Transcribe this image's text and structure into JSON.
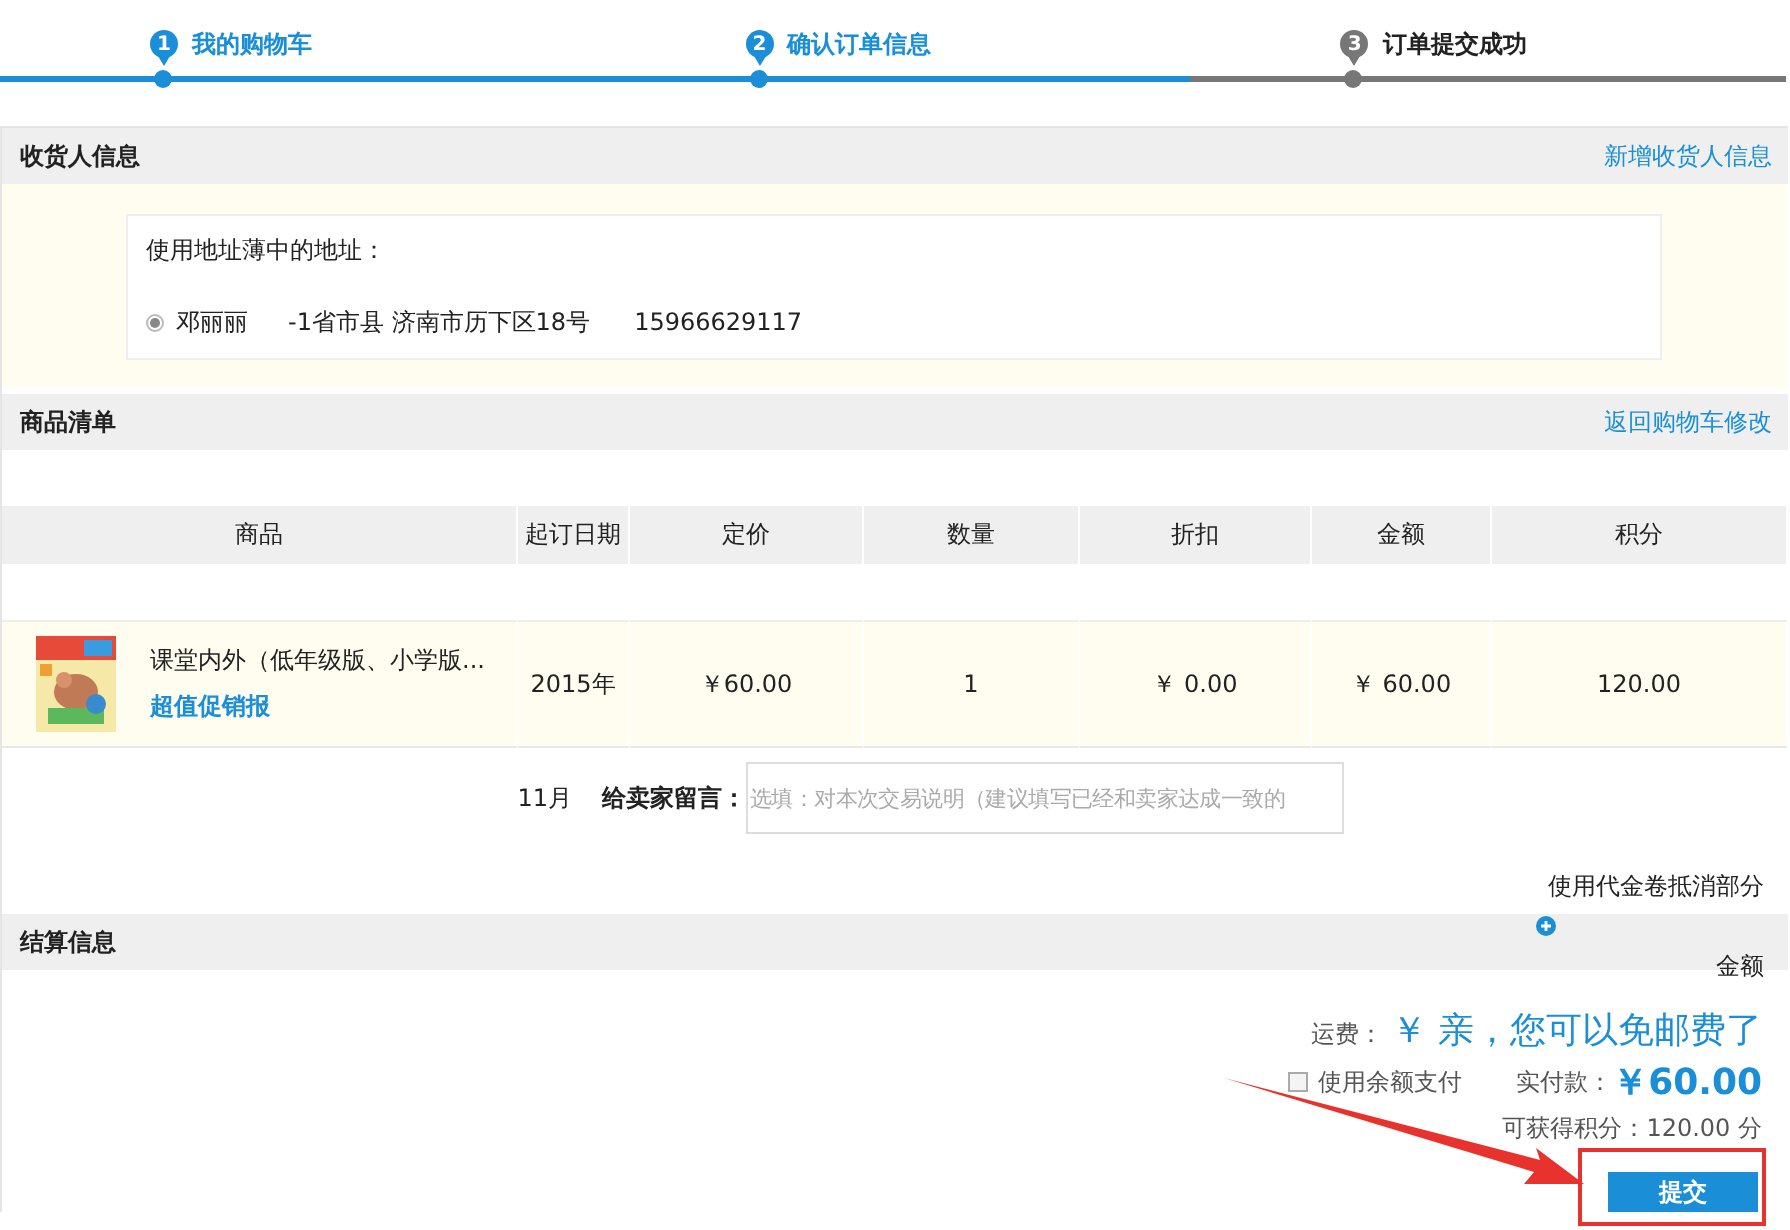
{
  "steps": [
    {
      "number": "1",
      "label": "我的购物车",
      "completed": true
    },
    {
      "number": "2",
      "label": "确认订单信息",
      "completed": true
    },
    {
      "number": "3",
      "label": "订单提交成功",
      "completed": false
    }
  ],
  "recipient": {
    "title": "收货人信息",
    "link": "新增收货人信息",
    "prompt": "使用地址薄中的地址：",
    "addresses": [
      {
        "selected": true,
        "name": "邓丽丽",
        "address": "-1省市县 济南市历下区18号",
        "phone": "15966629117"
      }
    ]
  },
  "goods": {
    "title": "商品清单",
    "link": "返回购物车修改",
    "columns": [
      "商品",
      "起订日期",
      "定价",
      "数量",
      "折扣",
      "金额",
      "积分"
    ],
    "rows": [
      {
        "kind": "picture",
        "product": "课堂内外（低年级版、小学版...",
        "promo": "超值促销报",
        "date": "2015年",
        "date_more": "11月",
        "price": "￥60.00",
        "quantity": "1",
        "discount": "￥ 0.00",
        "amount": "￥ 60.00",
        "points": "120.00"
      }
    ],
    "message": {
      "label": "给卖家留言：",
      "placeholder": "选填：对本次交易说明（建议填写已经和卖家达成一致的"
    },
    "voucher": "使用代金卷抵消部分"
  },
  "settlement": {
    "title": "结算信息",
    "amount_label": "金额",
    "shipping_label": "运费：",
    "shipping_value": "￥ 亲，您可以免邮费了",
    "balance": {
      "label": "使用余额支付",
      "checked": false
    },
    "payable_label": "实付款：",
    "payable_value": "￥60.00",
    "points_text": "可获得积分：120.00 分",
    "submit": "提交"
  }
}
